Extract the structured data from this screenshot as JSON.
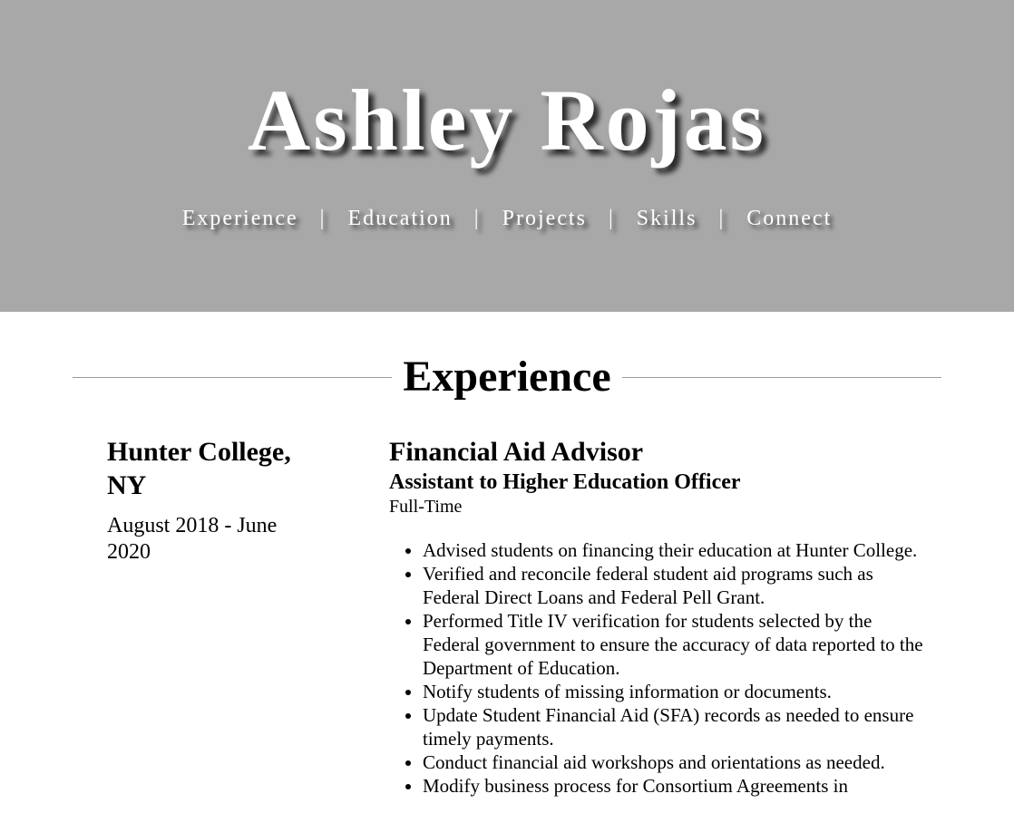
{
  "header": {
    "name": "Ashley Rojas",
    "nav": [
      {
        "label": "Experience"
      },
      {
        "label": "Education"
      },
      {
        "label": "Projects"
      },
      {
        "label": "Skills"
      },
      {
        "label": "Connect"
      }
    ],
    "separator": "|"
  },
  "section": {
    "title": "Experience"
  },
  "job": {
    "organization": "Hunter College, NY",
    "dates": "August 2018 - June 2020",
    "title": "Financial Aid Advisor",
    "subtitle": "Assistant to Higher Education Officer",
    "type": "Full-Time",
    "duties": [
      "Advised students on financing their education at Hunter College.",
      "Verified and reconcile federal student aid programs such as Federal Direct Loans and Federal Pell Grant.",
      "Performed Title IV verification for students selected by the Federal government to ensure the accuracy of data reported to the Department of Education.",
      "Notify students of missing information or documents.",
      "Update Student Financial Aid (SFA) records as needed to ensure timely payments.",
      "Conduct financial aid workshops and orientations as needed.",
      "Modify business process for Consortium Agreements in"
    ]
  },
  "colors": {
    "hero_background": "#a8a8a8",
    "rule": "#999999"
  }
}
